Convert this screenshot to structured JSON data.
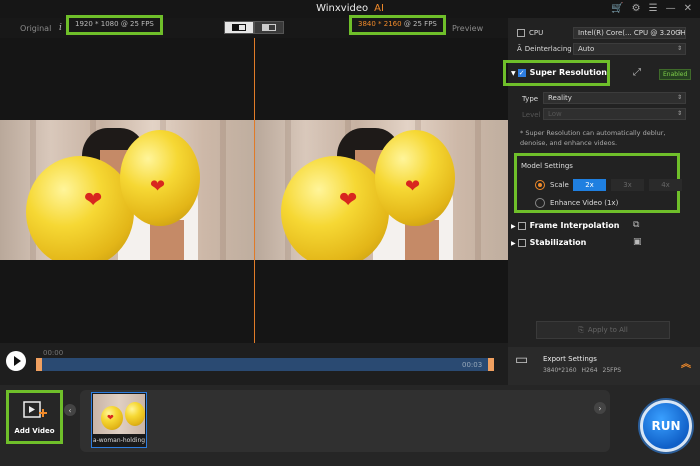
{
  "app": {
    "title": "Winxvideo",
    "title_suffix": "AI"
  },
  "header": {
    "original_label": "Original",
    "preview_label": "Preview",
    "input_resolution": "1920 * 1080",
    "input_fps": "@ 25 FPS",
    "output_resolution": "3840 * 2160",
    "output_fps": "@ 25 FPS"
  },
  "timeline": {
    "start_time": "00:00",
    "end_time": "00:03"
  },
  "panel": {
    "cpu_label": "CPU",
    "cpu_value": "Intel(R) Core(... CPU @ 3.20GH",
    "deinterlacing_label": "Deinterlacing",
    "deinterlacing_value": "Auto",
    "super_resolution": {
      "label": "Super Resolution",
      "checked": true,
      "status_badge": "Enabled",
      "type_label": "Type",
      "type_value": "Reality",
      "level_label": "Level",
      "level_value": "Low",
      "note": "* Super Resolution can automatically deblur, denoise, and enhance videos.",
      "model_settings_label": "Model Settings",
      "scale_label": "Scale",
      "scale_options": [
        "2x",
        "3x",
        "4x"
      ],
      "scale_selected": "2x",
      "enhance_label": "Enhance Video (1x)"
    },
    "frame_interpolation_label": "Frame Interpolation",
    "stabilization_label": "Stabilization",
    "apply_all_label": "Apply to All"
  },
  "export": {
    "title": "Export Settings",
    "resolution": "3840*2160",
    "codec": "H264",
    "fps": "25FPS"
  },
  "bottom": {
    "add_video_label": "Add Video",
    "thumbnail_caption": "a-woman-holding",
    "run_label": "RUN"
  },
  "colors": {
    "accent_orange": "#f08a2a",
    "accent_blue": "#1f7fe0",
    "highlight_green": "#6fbf2a"
  }
}
